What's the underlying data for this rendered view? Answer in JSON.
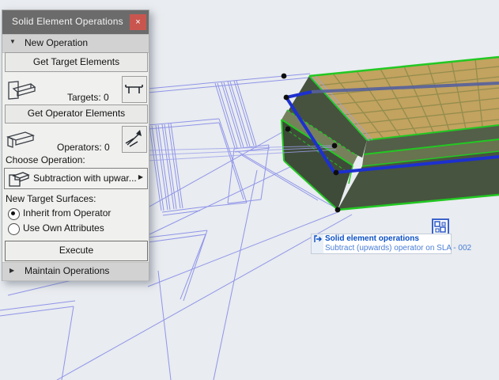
{
  "window": {
    "title": "Solid Element Operations",
    "close_glyph": "×"
  },
  "glyphs": {
    "expanded": "▼",
    "collapsed": "▶",
    "dropdown_arrow": "▶"
  },
  "panel": {
    "section_new": "New Operation",
    "section_maintain": "Maintain Operations",
    "get_targets_button": "Get Target Elements",
    "get_operators_button": "Get Operator Elements",
    "execute_button": "Execute",
    "targets": {
      "label": "Targets:",
      "count": "0"
    },
    "operators": {
      "label": "Operators:",
      "count": "0"
    },
    "choose_operation_label": "Choose Operation:",
    "operation_dropdown": {
      "value": "Subtraction with upwar..."
    },
    "new_target_surfaces_label": "New Target Surfaces:",
    "radio_inherit": {
      "label": "Inherit from Operator",
      "selected": true
    },
    "radio_own": {
      "label": "Use Own Attributes",
      "selected": false
    }
  },
  "viewport": {
    "datatip": {
      "title": "Solid element operations",
      "detail": "Subtract (upwards) operator on SLA - 002"
    },
    "colors": {
      "background": "#e9ecf0",
      "wireframe": "#8f94e9",
      "selection_green": "#22c822",
      "operator_blue": "#1d30cf",
      "slab_top": "#c2a35f",
      "slab_front": "#47543f"
    }
  }
}
